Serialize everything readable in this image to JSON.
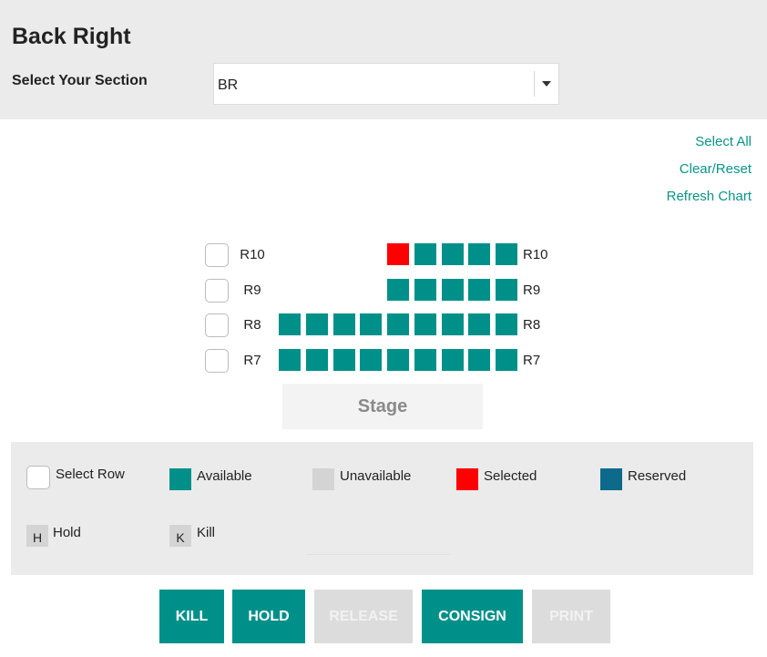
{
  "header": {
    "title": "Back Right",
    "section_label": "Select Your Section",
    "section_value": "BR"
  },
  "links": {
    "select_all": "Select All",
    "clear_reset": "Clear/Reset",
    "refresh_chart": "Refresh Chart"
  },
  "seat_chart": {
    "rows": [
      {
        "label": "R10",
        "seats": [
          "selected",
          "available",
          "available",
          "available",
          "available"
        ]
      },
      {
        "label": "R9",
        "seats": [
          "available",
          "available",
          "available",
          "available",
          "available"
        ]
      },
      {
        "label": "R8",
        "seats": [
          "available",
          "available",
          "available",
          "available",
          "available",
          "available",
          "available",
          "available",
          "available"
        ]
      },
      {
        "label": "R7",
        "seats": [
          "available",
          "available",
          "available",
          "available",
          "available",
          "available",
          "available",
          "available",
          "available"
        ]
      }
    ],
    "stage_label": "Stage"
  },
  "legend": {
    "select_row": "Select Row",
    "available": "Available",
    "unavailable": "Unavailable",
    "selected": "Selected",
    "reserved": "Reserved",
    "hold_code": "H",
    "hold": "Hold",
    "kill_code": "K",
    "kill": "Kill"
  },
  "colors": {
    "available": "#00908a",
    "unavailable": "#d4d4d4",
    "selected": "#ff0000",
    "reserved": "#0d6a8a"
  },
  "buttons": {
    "kill": "KILL",
    "hold": "HOLD",
    "release": "RELEASE",
    "consign": "CONSIGN",
    "print": "PRINT"
  }
}
